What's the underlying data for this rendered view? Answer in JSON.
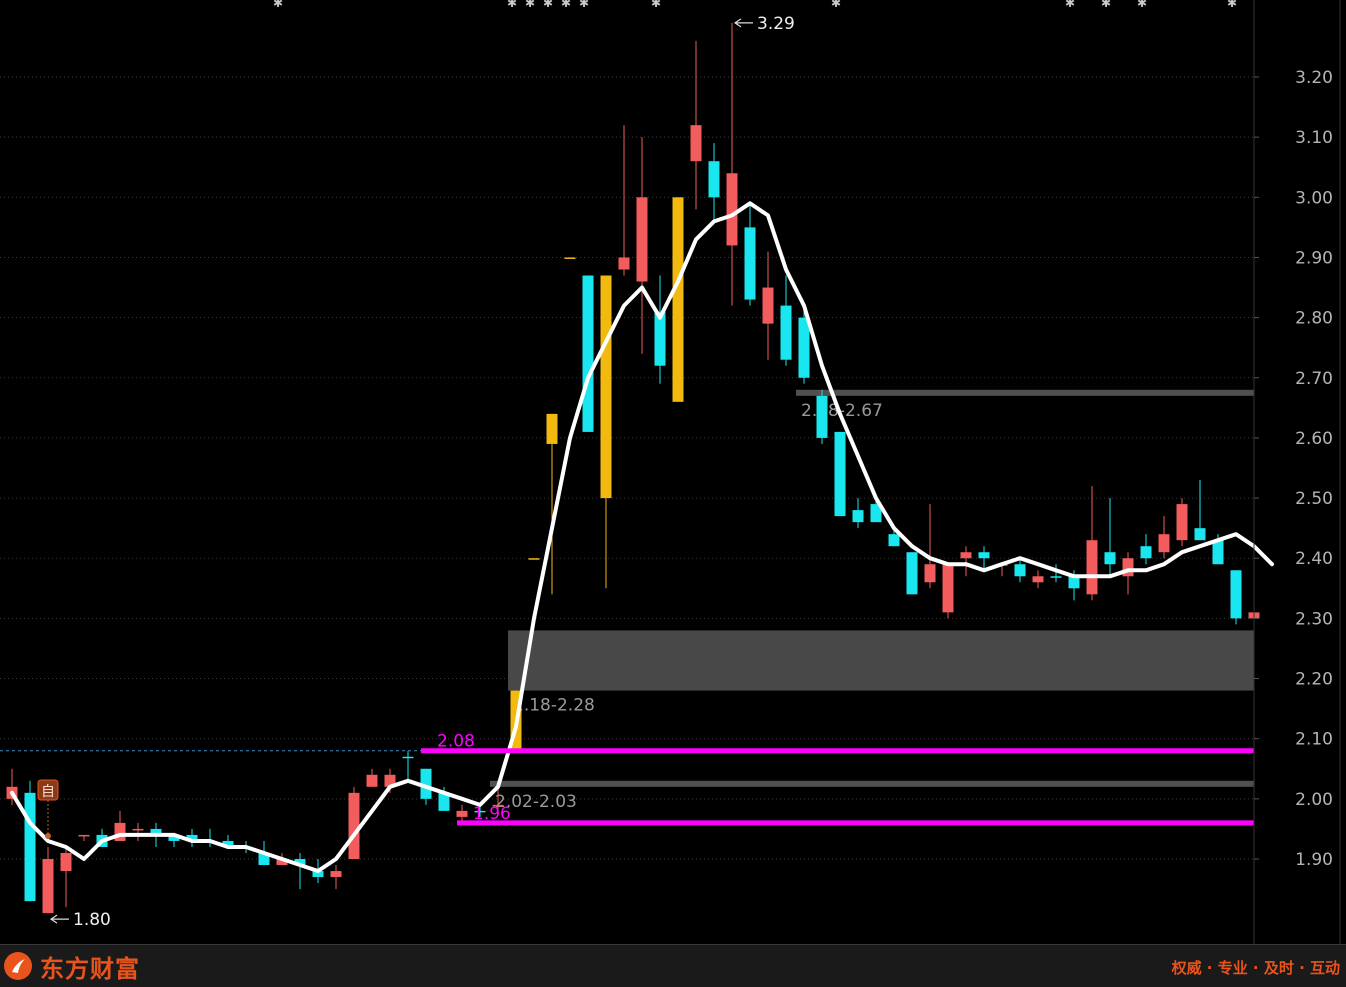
{
  "colors": {
    "background": "#000000",
    "up": "#f25c5c",
    "down": "#19e6ee",
    "highlight": "#f2b90f",
    "ma": "#ffffff",
    "support_line": "#ff00ff",
    "zone_fill": "#484848",
    "zone_line": "#505050",
    "grid": "#3a3a3a",
    "axis_text": "#b4b4b4",
    "brand": "#e8541c"
  },
  "chart_data": {
    "type": "candlestick",
    "ylim": [
      1.76,
      3.36
    ],
    "y_ticks": [
      "3.20",
      "3.10",
      "3.00",
      "2.90",
      "2.80",
      "2.70",
      "2.60",
      "2.50",
      "2.40",
      "2.30",
      "2.20",
      "2.10",
      "2.00",
      "1.90"
    ],
    "candles": [
      {
        "o": 2.0,
        "h": 2.05,
        "l": 1.99,
        "c": 2.02,
        "t": "up"
      },
      {
        "o": 2.01,
        "h": 2.03,
        "l": 1.83,
        "c": 1.83,
        "t": "down"
      },
      {
        "o": 1.9,
        "h": 1.92,
        "l": 1.81,
        "c": 1.81,
        "t": "up"
      },
      {
        "o": 1.88,
        "h": 1.92,
        "l": 1.82,
        "c": 1.91,
        "t": "up"
      },
      {
        "o": 1.94,
        "h": 1.94,
        "l": 1.93,
        "c": 1.94,
        "t": "up"
      },
      {
        "o": 1.94,
        "h": 1.95,
        "l": 1.92,
        "c": 1.92,
        "t": "down"
      },
      {
        "o": 1.93,
        "h": 1.98,
        "l": 1.93,
        "c": 1.96,
        "t": "up"
      },
      {
        "o": 1.95,
        "h": 1.96,
        "l": 1.93,
        "c": 1.95,
        "t": "up"
      },
      {
        "o": 1.95,
        "h": 1.96,
        "l": 1.92,
        "c": 1.94,
        "t": "down"
      },
      {
        "o": 1.94,
        "h": 1.94,
        "l": 1.92,
        "c": 1.93,
        "t": "down"
      },
      {
        "o": 1.94,
        "h": 1.95,
        "l": 1.92,
        "c": 1.93,
        "t": "down"
      },
      {
        "o": 1.93,
        "h": 1.95,
        "l": 1.92,
        "c": 1.93,
        "t": "down"
      },
      {
        "o": 1.93,
        "h": 1.94,
        "l": 1.92,
        "c": 1.92,
        "t": "down"
      },
      {
        "o": 1.92,
        "h": 1.93,
        "l": 1.91,
        "c": 1.92,
        "t": "down"
      },
      {
        "o": 1.91,
        "h": 1.93,
        "l": 1.89,
        "c": 1.89,
        "t": "down"
      },
      {
        "o": 1.89,
        "h": 1.91,
        "l": 1.89,
        "c": 1.9,
        "t": "up"
      },
      {
        "o": 1.9,
        "h": 1.91,
        "l": 1.85,
        "c": 1.89,
        "t": "down"
      },
      {
        "o": 1.88,
        "h": 1.9,
        "l": 1.86,
        "c": 1.87,
        "t": "down"
      },
      {
        "o": 1.87,
        "h": 1.89,
        "l": 1.85,
        "c": 1.88,
        "t": "up"
      },
      {
        "o": 1.9,
        "h": 2.02,
        "l": 1.9,
        "c": 2.01,
        "t": "up"
      },
      {
        "o": 2.02,
        "h": 2.05,
        "l": 2.02,
        "c": 2.04,
        "t": "up"
      },
      {
        "o": 2.02,
        "h": 2.05,
        "l": 2.01,
        "c": 2.04,
        "t": "up"
      },
      {
        "o": 2.07,
        "h": 2.08,
        "l": 2.03,
        "c": 2.07,
        "t": "down"
      },
      {
        "o": 2.05,
        "h": 2.05,
        "l": 1.99,
        "c": 2.0,
        "t": "down"
      },
      {
        "o": 2.01,
        "h": 2.02,
        "l": 1.98,
        "c": 1.98,
        "t": "down"
      },
      {
        "o": 1.97,
        "h": 1.99,
        "l": 1.96,
        "c": 1.98,
        "t": "up"
      },
      {
        "o": 1.98,
        "h": 1.99,
        "l": 1.97,
        "c": 1.98,
        "t": "down"
      },
      {
        "o": 1.99,
        "h": 2.02,
        "l": 1.98,
        "c": 1.99,
        "t": "up"
      },
      {
        "o": 2.08,
        "h": 2.18,
        "l": 2.08,
        "c": 2.18,
        "t": "hl"
      },
      {
        "o": 2.4,
        "h": 2.4,
        "l": 2.4,
        "c": 2.4,
        "t": "hl"
      },
      {
        "o": 2.59,
        "h": 2.64,
        "l": 2.34,
        "c": 2.64,
        "t": "hl"
      },
      {
        "o": 2.9,
        "h": 2.9,
        "l": 2.9,
        "c": 2.9,
        "t": "hl"
      },
      {
        "o": 2.87,
        "h": 2.87,
        "l": 2.61,
        "c": 2.61,
        "t": "down"
      },
      {
        "o": 2.87,
        "h": 2.87,
        "l": 2.35,
        "c": 2.5,
        "t": "hl"
      },
      {
        "o": 2.88,
        "h": 3.12,
        "l": 2.87,
        "c": 2.9,
        "t": "up"
      },
      {
        "o": 2.86,
        "h": 3.1,
        "l": 2.74,
        "c": 3.0,
        "t": "up"
      },
      {
        "o": 2.81,
        "h": 2.87,
        "l": 2.69,
        "c": 2.72,
        "t": "down"
      },
      {
        "o": 2.66,
        "h": 3.0,
        "l": 2.66,
        "c": 3.0,
        "t": "hl"
      },
      {
        "o": 3.06,
        "h": 3.26,
        "l": 2.98,
        "c": 3.12,
        "t": "up"
      },
      {
        "o": 3.06,
        "h": 3.09,
        "l": 2.96,
        "c": 3.0,
        "t": "down"
      },
      {
        "o": 2.92,
        "h": 3.29,
        "l": 2.82,
        "c": 3.04,
        "t": "up"
      },
      {
        "o": 2.95,
        "h": 2.99,
        "l": 2.82,
        "c": 2.83,
        "t": "down"
      },
      {
        "o": 2.79,
        "h": 2.91,
        "l": 2.73,
        "c": 2.85,
        "t": "up"
      },
      {
        "o": 2.82,
        "h": 2.87,
        "l": 2.72,
        "c": 2.73,
        "t": "down"
      },
      {
        "o": 2.8,
        "h": 2.82,
        "l": 2.69,
        "c": 2.7,
        "t": "down"
      },
      {
        "o": 2.67,
        "h": 2.68,
        "l": 2.59,
        "c": 2.6,
        "t": "down"
      },
      {
        "o": 2.61,
        "h": 2.61,
        "l": 2.47,
        "c": 2.47,
        "t": "down"
      },
      {
        "o": 2.48,
        "h": 2.5,
        "l": 2.45,
        "c": 2.46,
        "t": "down"
      },
      {
        "o": 2.49,
        "h": 2.5,
        "l": 2.46,
        "c": 2.46,
        "t": "down"
      },
      {
        "o": 2.44,
        "h": 2.45,
        "l": 2.42,
        "c": 2.42,
        "t": "down"
      },
      {
        "o": 2.41,
        "h": 2.41,
        "l": 2.34,
        "c": 2.34,
        "t": "down"
      },
      {
        "o": 2.36,
        "h": 2.49,
        "l": 2.35,
        "c": 2.39,
        "t": "up"
      },
      {
        "o": 2.31,
        "h": 2.39,
        "l": 2.3,
        "c": 2.39,
        "t": "up"
      },
      {
        "o": 2.4,
        "h": 2.42,
        "l": 2.37,
        "c": 2.41,
        "t": "up"
      },
      {
        "o": 2.41,
        "h": 2.42,
        "l": 2.38,
        "c": 2.4,
        "t": "down"
      },
      {
        "o": 2.39,
        "h": 2.39,
        "l": 2.37,
        "c": 2.39,
        "t": "up"
      },
      {
        "o": 2.39,
        "h": 2.4,
        "l": 2.36,
        "c": 2.37,
        "t": "down"
      },
      {
        "o": 2.36,
        "h": 2.38,
        "l": 2.35,
        "c": 2.37,
        "t": "up"
      },
      {
        "o": 2.37,
        "h": 2.39,
        "l": 2.36,
        "c": 2.37,
        "t": "down"
      },
      {
        "o": 2.37,
        "h": 2.38,
        "l": 2.33,
        "c": 2.35,
        "t": "down"
      },
      {
        "o": 2.34,
        "h": 2.52,
        "l": 2.33,
        "c": 2.43,
        "t": "up"
      },
      {
        "o": 2.41,
        "h": 2.5,
        "l": 2.37,
        "c": 2.39,
        "t": "down"
      },
      {
        "o": 2.37,
        "h": 2.41,
        "l": 2.34,
        "c": 2.4,
        "t": "up"
      },
      {
        "o": 2.42,
        "h": 2.44,
        "l": 2.39,
        "c": 2.4,
        "t": "down"
      },
      {
        "o": 2.41,
        "h": 2.47,
        "l": 2.4,
        "c": 2.44,
        "t": "up"
      },
      {
        "o": 2.43,
        "h": 2.5,
        "l": 2.42,
        "c": 2.49,
        "t": "up"
      },
      {
        "o": 2.45,
        "h": 2.53,
        "l": 2.43,
        "c": 2.43,
        "t": "down"
      },
      {
        "o": 2.43,
        "h": 2.44,
        "l": 2.39,
        "c": 2.39,
        "t": "down"
      },
      {
        "o": 2.38,
        "h": 2.38,
        "l": 2.29,
        "c": 2.3,
        "t": "down"
      },
      {
        "o": 2.3,
        "h": 2.32,
        "l": 2.29,
        "c": 2.31,
        "t": "up"
      }
    ],
    "ma": [
      2.01,
      1.96,
      1.93,
      1.92,
      1.9,
      1.93,
      1.94,
      1.94,
      1.94,
      1.94,
      1.93,
      1.93,
      1.92,
      1.92,
      1.91,
      1.9,
      1.89,
      1.88,
      1.9,
      1.94,
      1.98,
      2.02,
      2.03,
      2.02,
      2.01,
      2.0,
      1.99,
      2.02,
      2.12,
      2.3,
      2.45,
      2.6,
      2.7,
      2.76,
      2.82,
      2.85,
      2.8,
      2.86,
      2.93,
      2.96,
      2.97,
      2.99,
      2.97,
      2.88,
      2.82,
      2.72,
      2.64,
      2.57,
      2.5,
      2.45,
      2.42,
      2.4,
      2.39,
      2.39,
      2.38,
      2.39,
      2.4,
      2.39,
      2.38,
      2.37,
      2.37,
      2.37,
      2.38,
      2.38,
      2.39,
      2.41,
      2.42,
      2.43,
      2.44,
      2.42,
      2.39
    ],
    "ma_start_index": 0,
    "support_lines": [
      {
        "value": 2.08,
        "label": "2.08",
        "start_index": 23,
        "dashed_from_start": true
      },
      {
        "value": 1.96,
        "label": "1.96",
        "start_index": 25,
        "dashed_from_start": false
      }
    ],
    "zones": [
      {
        "from": 2.18,
        "to": 2.28,
        "label": "2.18-2.28",
        "start_index": 28
      },
      {
        "from": 2.67,
        "to": 2.68,
        "label": "2.68-2.67",
        "start_index": 44
      },
      {
        "from": 2.02,
        "to": 2.03,
        "label": "2.02-2.03",
        "start_index": 27
      }
    ],
    "extremes": [
      {
        "label": "3.29",
        "index": 40,
        "value": 3.29,
        "position": "high"
      },
      {
        "label": "1.80",
        "index": 2,
        "value": 1.81,
        "position": "low"
      }
    ],
    "marker": {
      "label": "自",
      "index": 2
    },
    "top_markers_at_index": [
      15,
      28,
      29,
      30,
      31,
      32,
      36,
      46,
      59,
      61,
      63,
      68
    ]
  },
  "footer": {
    "brand_name": "东方财富",
    "slogan": "权威 · 专业 · 及时 · 互动"
  }
}
